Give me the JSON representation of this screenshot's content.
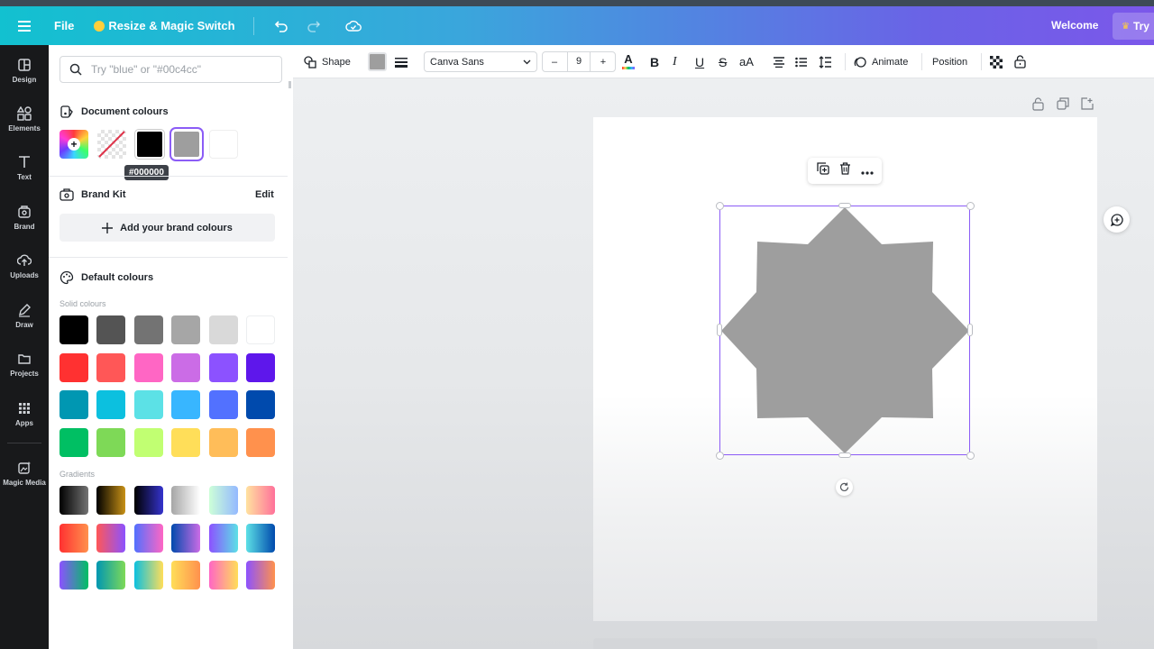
{
  "topbar": {
    "file_label": "File",
    "resize_label": "Resize & Magic Switch",
    "welcome_label": "Welcome",
    "try_label": "Try"
  },
  "leftnav": {
    "items": [
      {
        "label": "Design",
        "icon": "design-icon"
      },
      {
        "label": "Elements",
        "icon": "elements-icon"
      },
      {
        "label": "Text",
        "icon": "text-icon"
      },
      {
        "label": "Brand",
        "icon": "brand-icon"
      },
      {
        "label": "Uploads",
        "icon": "uploads-icon"
      },
      {
        "label": "Draw",
        "icon": "draw-icon"
      },
      {
        "label": "Projects",
        "icon": "projects-icon"
      },
      {
        "label": "Apps",
        "icon": "apps-icon"
      },
      {
        "label": "Magic Media",
        "icon": "magic-media-icon"
      }
    ]
  },
  "panel": {
    "search_placeholder": "Try \"blue\" or \"#00c4cc\"",
    "document_colours_title": "Document colours",
    "document_colours": [
      "rainbow-add",
      "transparent",
      "#000000",
      "#9e9e9e",
      "#ffffff"
    ],
    "tooltip": "#000000",
    "brand_kit_title": "Brand Kit",
    "brand_kit_edit": "Edit",
    "add_brand_label": "Add your brand colours",
    "default_colours_title": "Default colours",
    "solid_label": "Solid colours",
    "solid_colours": [
      "#000000",
      "#545454",
      "#737373",
      "#a6a6a6",
      "#d9d9d9",
      "#ffffff",
      "#ff3131",
      "#ff5757",
      "#ff66c4",
      "#cb6ce6",
      "#8c52ff",
      "#5e17eb",
      "#0097b2",
      "#0cc0df",
      "#5ce1e6",
      "#38b6ff",
      "#5271ff",
      "#004aad",
      "#00bf63",
      "#7ed957",
      "#c1ff72",
      "#ffde59",
      "#ffbd59",
      "#ff914d"
    ],
    "gradients_label": "Gradients",
    "gradients": [
      [
        "#000000",
        "#737373"
      ],
      [
        "#000000",
        "#c89116"
      ],
      [
        "#000000",
        "#3533cd"
      ],
      [
        "#a6a6a6",
        "#ffffff"
      ],
      [
        "#cdffd8",
        "#94b9ff"
      ],
      [
        "#ffe29f",
        "#ff719a"
      ],
      [
        "#ff3131",
        "#ff914d"
      ],
      [
        "#ff5757",
        "#8c52ff"
      ],
      [
        "#5170ff",
        "#ff66c4"
      ],
      [
        "#004aad",
        "#cb6ce6"
      ],
      [
        "#8c52ff",
        "#5ce1e6"
      ],
      [
        "#5de0e6",
        "#004aad"
      ],
      [
        "#8c52ff",
        "#00bf63"
      ],
      [
        "#0097b2",
        "#7ed957"
      ],
      [
        "#0cc0df",
        "#ffde59"
      ],
      [
        "#ffde59",
        "#ff914d"
      ],
      [
        "#ff66c4",
        "#ffde59"
      ],
      [
        "#8c52ff",
        "#ff914d"
      ]
    ]
  },
  "ctxbar": {
    "shape_label": "Shape",
    "font_name": "Canva Sans",
    "font_size": "9",
    "minus": "–",
    "plus": "+",
    "animate_label": "Animate",
    "position_label": "Position",
    "fill_color": "#9e9e9e"
  },
  "canvas": {
    "shape_fill": "#9e9e9e",
    "selection_color": "#8b5cf6"
  }
}
